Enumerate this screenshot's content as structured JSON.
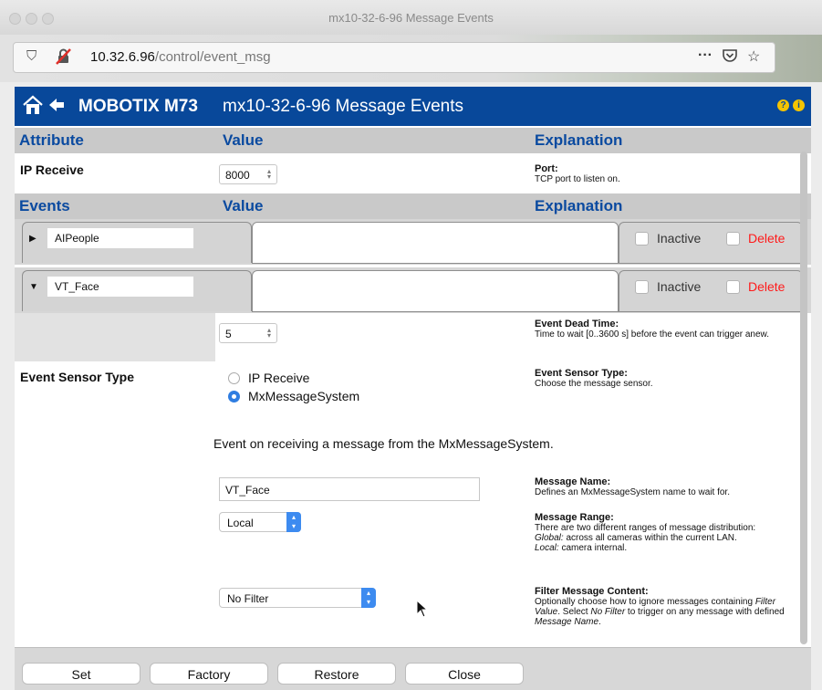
{
  "window": {
    "title": "mx10-32-6-96 Message Events"
  },
  "browser": {
    "url_host": "10.32.6.96",
    "url_path": "/control/event_msg",
    "menu_dots": "···"
  },
  "header": {
    "brand": "MOBOTIX M73",
    "title": "mx10-32-6-96 Message Events"
  },
  "columns": {
    "attribute": "Attribute",
    "value": "Value",
    "explanation": "Explanation"
  },
  "ip_receive": {
    "label": "IP Receive",
    "value": "8000",
    "expl_title": "Port",
    "expl_text": "TCP port to listen on."
  },
  "events_header": {
    "events": "Events",
    "value": "Value",
    "explanation": "Explanation"
  },
  "events": [
    {
      "name": "AIPeople",
      "inactive_label": "Inactive",
      "delete_label": "Delete"
    },
    {
      "name": "VT_Face",
      "inactive_label": "Inactive",
      "delete_label": "Delete"
    }
  ],
  "dead_time": {
    "value": "5",
    "expl_title": "Event Dead Time",
    "expl_text": "Time to wait [0..3600 s] before the event can trigger anew."
  },
  "sensor_type": {
    "label": "Event Sensor Type",
    "options": [
      "IP Receive",
      "MxMessageSystem"
    ],
    "selected": "MxMessageSystem",
    "expl_title": "Event Sensor Type",
    "expl_text": "Choose the message sensor."
  },
  "mx_section": {
    "heading": "Event on receiving a message from the MxMessageSystem."
  },
  "message_name": {
    "value": "VT_Face",
    "expl_title": "Message Name",
    "expl_text": "Defines an MxMessageSystem name to wait for."
  },
  "message_range": {
    "value": "Local",
    "expl_title": "Message Range",
    "expl_text": "There are two different ranges of message distribution:",
    "global_term": "Global",
    "global_text": "across all cameras within the current LAN.",
    "local_term": "Local",
    "local_text": "camera internal."
  },
  "filter": {
    "value": "No Filter",
    "expl_title": "Filter Message Content",
    "expl_text_1": "Optionally choose how to ignore messages containing ",
    "expl_term_1": "Filter Value",
    "expl_text_2": ". Select ",
    "expl_term_2": "No Filter",
    "expl_text_3": " to trigger on any message with defined ",
    "expl_term_3": "Message Name",
    "expl_text_4": "."
  },
  "buttons": {
    "set": "Set",
    "factory": "Factory",
    "restore": "Restore",
    "close": "Close"
  },
  "colors": {
    "header_blue": "#08489a",
    "link_blue": "#0a4aa0",
    "delete_red": "#ff1a1a",
    "accent": "#3d8bf0"
  }
}
